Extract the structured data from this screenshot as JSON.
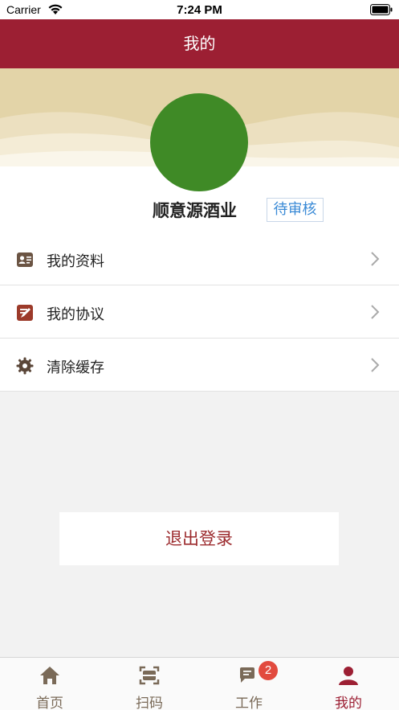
{
  "status_bar": {
    "carrier": "Carrier",
    "time": "7:24 PM"
  },
  "nav": {
    "title": "我的"
  },
  "profile": {
    "name": "顺意源酒业",
    "status": "待审核",
    "avatar_color": "#3f8a26"
  },
  "menu": {
    "items": [
      {
        "label": "我的资料",
        "icon": "id-card-icon"
      },
      {
        "label": "我的协议",
        "icon": "document-edit-icon"
      },
      {
        "label": "清除缓存",
        "icon": "gear-icon"
      }
    ]
  },
  "logout": {
    "label": "退出登录"
  },
  "tabs": {
    "items": [
      {
        "label": "首页",
        "icon": "home-icon"
      },
      {
        "label": "扫码",
        "icon": "scan-icon"
      },
      {
        "label": "工作",
        "icon": "chat-icon",
        "badge": "2"
      },
      {
        "label": "我的",
        "icon": "user-icon"
      }
    ],
    "active_index": 3
  },
  "colors": {
    "brand": "#9c1f33",
    "banner": "#e3d4a8",
    "link": "#3a8ad6",
    "badge": "#e24a3e"
  }
}
